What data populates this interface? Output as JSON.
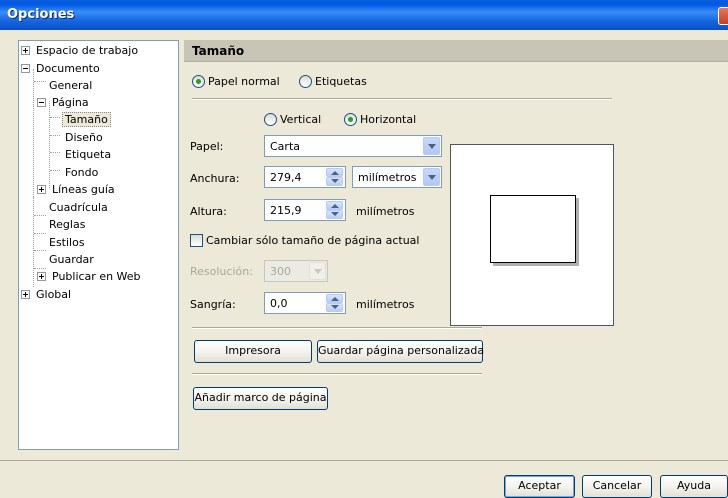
{
  "window": {
    "title": "Opciones"
  },
  "tree": {
    "items": [
      {
        "label": "Espacio de trabajo"
      },
      {
        "label": "Documento"
      },
      {
        "label": "General"
      },
      {
        "label": "Página"
      },
      {
        "label": "Tamaño"
      },
      {
        "label": "Diseño"
      },
      {
        "label": "Etiqueta"
      },
      {
        "label": "Fondo"
      },
      {
        "label": "Líneas guía"
      },
      {
        "label": "Cuadrícula"
      },
      {
        "label": "Reglas"
      },
      {
        "label": "Estilos"
      },
      {
        "label": "Guardar"
      },
      {
        "label": "Publicar en Web"
      },
      {
        "label": "Global"
      }
    ],
    "selected": "Tamaño"
  },
  "panel": {
    "header": "Tamaño",
    "paper_type": {
      "normal": "Papel normal",
      "labels": "Etiquetas",
      "selected": "Papel normal"
    },
    "orientation": {
      "vertical": "Vertical",
      "horizontal": "Horizontal",
      "selected": "Horizontal"
    },
    "paper": {
      "label": "Papel:",
      "value": "Carta"
    },
    "width": {
      "label": "Anchura:",
      "value": "279,4",
      "unit": "milímetros"
    },
    "height": {
      "label": "Altura:",
      "value": "215,9",
      "unit": "milímetros"
    },
    "current_page_only": {
      "label": "Cambiar sólo tamaño de página actual",
      "checked": false
    },
    "resolution": {
      "label": "Resolución:",
      "value": "300",
      "enabled": false
    },
    "bleed": {
      "label": "Sangría:",
      "value": "0,0",
      "unit": "milímetros"
    },
    "printer_button": "Impresora",
    "save_custom_button": "Guardar página personalizada",
    "add_frame_button": "Añadir marco de página"
  },
  "footer": {
    "ok": "Aceptar",
    "cancel": "Cancelar",
    "help": "Ayuda"
  }
}
